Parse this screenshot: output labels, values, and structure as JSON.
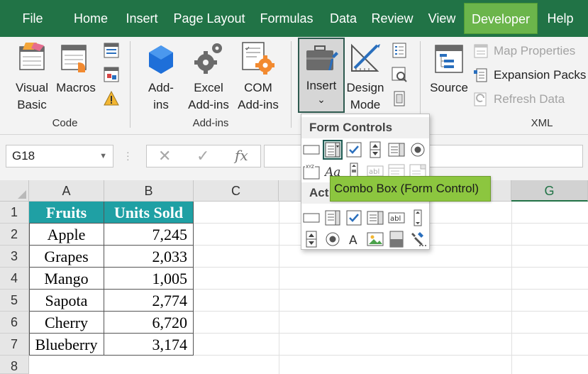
{
  "menu": {
    "tabs": [
      "File",
      "Home",
      "Insert",
      "Page Layout",
      "Formulas",
      "Data",
      "Review",
      "View",
      "Developer",
      "Help"
    ],
    "active_tab": "Developer",
    "active_color": "#6bb54b",
    "bar_color": "#217346"
  },
  "ribbon": {
    "code": {
      "visual_basic": [
        "Visual",
        "Basic"
      ],
      "macros": "Macros",
      "group_label": "Code"
    },
    "addins": {
      "addins": [
        "Add-",
        "ins"
      ],
      "excel_addins": [
        "Excel",
        "Add-ins"
      ],
      "com_addins": [
        "COM",
        "Add-ins"
      ],
      "group_label": "Add-ins"
    },
    "controls": {
      "insert": "Insert",
      "insert_caret": "⌄",
      "design_mode": [
        "Design",
        "Mode"
      ]
    },
    "xml": {
      "source": "Source",
      "map_properties": "Map Properties",
      "expansion_packs": "Expansion Packs",
      "refresh_data": "Refresh Data",
      "group_label": "XML"
    }
  },
  "formula_bar": {
    "name_box": "G18",
    "cancel": "✕",
    "enter": "✓",
    "fx": "fx",
    "value": ""
  },
  "grid": {
    "columns": [
      "A",
      "B",
      "C",
      "G"
    ],
    "selected_column": "G",
    "rows": [
      "1",
      "2",
      "3",
      "4",
      "5",
      "6",
      "7",
      "8"
    ],
    "table": {
      "headers": [
        "Fruits",
        "Units Sold"
      ],
      "header_color": "#1fa0a4",
      "rows": [
        [
          "Apple",
          "7,245"
        ],
        [
          "Grapes",
          "2,033"
        ],
        [
          "Mango",
          "1,005"
        ],
        [
          "Sapota",
          "2,774"
        ],
        [
          "Cherry",
          "6,720"
        ],
        [
          "Blueberry",
          "3,174"
        ]
      ]
    }
  },
  "insert_dropdown": {
    "form_controls_label": "Form Controls",
    "activex_label": "Act",
    "highlighted_control": "combo-box",
    "tooltip": "Combo Box (Form Control)",
    "tooltip_color": "#8cc63f"
  }
}
